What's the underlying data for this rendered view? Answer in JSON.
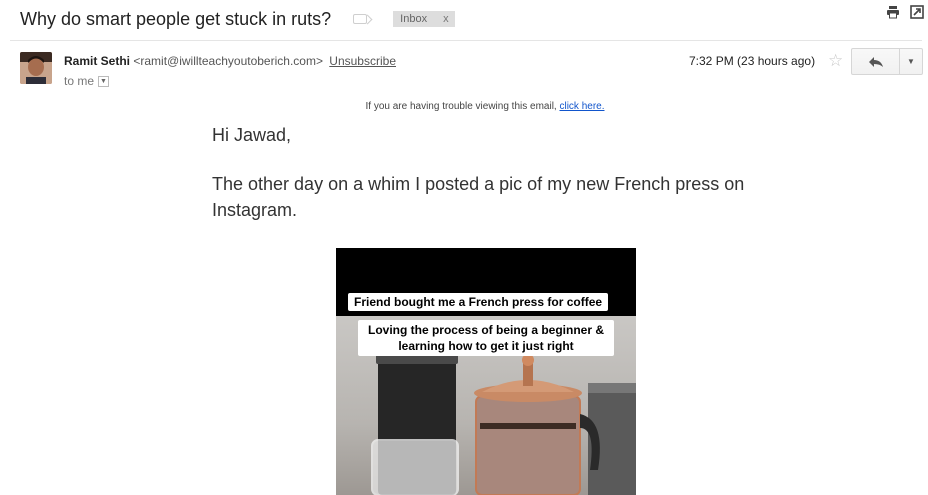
{
  "email": {
    "subject": "Why do smart people get stuck in ruts?",
    "inbox_label": "Inbox",
    "inbox_close": "x",
    "sender": {
      "name": "Ramit Sethi",
      "address": "<ramit@iwillteachyoutoberich.com>",
      "unsubscribe": "Unsubscribe"
    },
    "recipient": "to me",
    "time": "7:32 PM (23 hours ago)",
    "trouble_text": "If you are having trouble viewing this email,",
    "trouble_link": "click here.",
    "greeting": "Hi Jawad,",
    "paragraph": "The other day on a whim I posted a pic of my new French press on Instagram.",
    "image": {
      "caption_1": "Friend bought me a French press for coffee",
      "caption_2": "Loving the process of being a beginner & learning how to get it just right"
    }
  },
  "icons": {
    "print": "printer-icon",
    "new_window": "new-window-icon",
    "star": "star-icon",
    "reply": "reply-icon",
    "more": "chevron-down-icon",
    "label": "label-icon"
  },
  "colors": {
    "link": "#1155cc",
    "chip_bg": "#dddddd",
    "divider": "#e5e5e5"
  }
}
